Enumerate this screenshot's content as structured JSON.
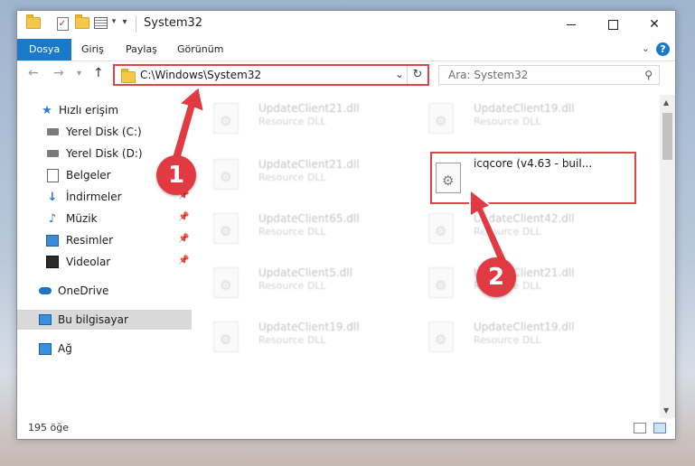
{
  "window": {
    "title": "System32",
    "caption": {
      "minimize": "",
      "maximize": "",
      "close": "✕"
    }
  },
  "ribbon": {
    "tabs": [
      {
        "label": "Dosya"
      },
      {
        "label": "Giriş"
      },
      {
        "label": "Paylaş"
      },
      {
        "label": "Görünüm"
      }
    ],
    "help": "?"
  },
  "address": {
    "path": "C:\\Windows\\System32",
    "search_placeholder": "Ara: System32"
  },
  "sidebar": {
    "items": [
      {
        "label": "Hızlı erişim",
        "icon": "star-icon"
      },
      {
        "label": "Yerel Disk (C:)",
        "icon": "drive-icon"
      },
      {
        "label": "Yerel Disk (D:)",
        "icon": "drive-icon"
      },
      {
        "label": "Belgeler",
        "icon": "documents-icon"
      },
      {
        "label": "İndirmeler",
        "icon": "downloads-icon"
      },
      {
        "label": "Müzik",
        "icon": "music-icon"
      },
      {
        "label": "Resimler",
        "icon": "pictures-icon"
      },
      {
        "label": "Videolar",
        "icon": "videos-icon"
      },
      {
        "label": "OneDrive",
        "icon": "onedrive-icon"
      },
      {
        "label": "Bu bilgisayar",
        "icon": "computer-icon"
      },
      {
        "label": "Ağ",
        "icon": "network-icon"
      }
    ],
    "selected": "Bu bilgisayar"
  },
  "files": [
    {
      "name": "UpdateClient21.dll",
      "type": "Resource DLL"
    },
    {
      "name": "UpdateClient19.dll",
      "type": "Resource DLL"
    },
    {
      "name": "UpdateClient21.dll",
      "type": "Resource DLL"
    },
    {
      "name": "icqcore (v4.63 - buil...",
      "type": ""
    },
    {
      "name": "UpdateClient65.dll",
      "type": "Resource DLL"
    },
    {
      "name": "UpdateClient42.dll",
      "type": "Resource DLL"
    },
    {
      "name": "UpdateClient5.dll",
      "type": "Resource DLL"
    },
    {
      "name": "UpdateClient21.dll",
      "type": "Resource DLL"
    },
    {
      "name": "UpdateClient19.dll",
      "type": "Resource DLL"
    },
    {
      "name": "UpdateClient19.dll",
      "type": "Resource DLL"
    }
  ],
  "status": {
    "count": "195 öğe"
  },
  "annotations": {
    "step1": "1",
    "step2": "2",
    "highlight_color": "#e0444a"
  }
}
